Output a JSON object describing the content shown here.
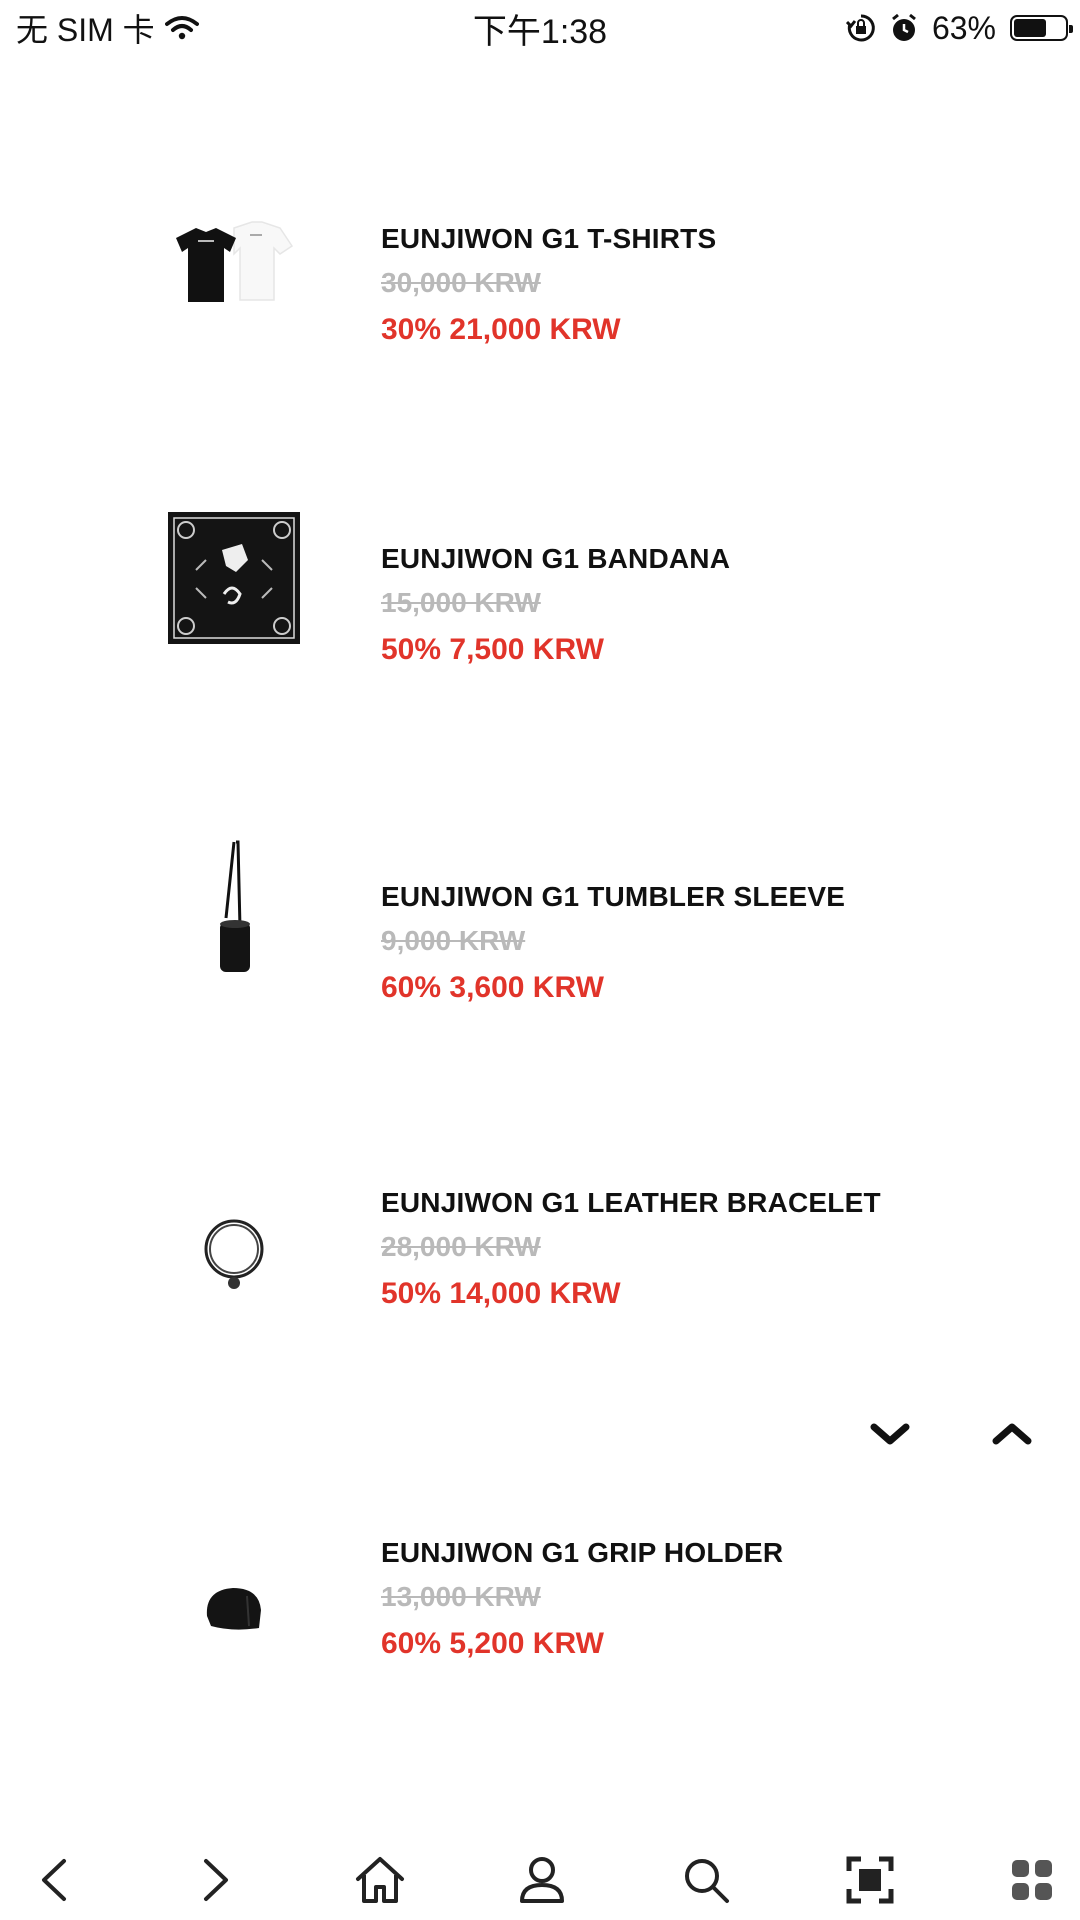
{
  "status_bar": {
    "carrier": "无 SIM 卡",
    "time": "下午1:38",
    "battery_percent": "63%",
    "battery_level": 0.63,
    "icons": [
      "wifi-icon",
      "orientation-lock-icon",
      "alarm-icon",
      "battery-icon"
    ]
  },
  "products": [
    {
      "name": "EUNJIWON G1 T-SHIRTS",
      "original_price": "30,000 KRW",
      "sale_price": "30% 21,000 KRW"
    },
    {
      "name": "EUNJIWON G1 BANDANA",
      "original_price": "15,000 KRW",
      "sale_price": "50% 7,500 KRW"
    },
    {
      "name": "EUNJIWON G1 TUMBLER SLEEVE",
      "original_price": "9,000 KRW",
      "sale_price": "60% 3,600 KRW"
    },
    {
      "name": "EUNJIWON G1 LEATHER BRACELET",
      "original_price": "28,000 KRW",
      "sale_price": "50% 14,000 KRW"
    },
    {
      "name": "EUNJIWON G1 GRIP HOLDER",
      "original_price": "13,000 KRW",
      "sale_price": "60% 5,200 KRW"
    }
  ],
  "scroll_controls": [
    "chevron-down-icon",
    "chevron-up-icon"
  ],
  "bottom_nav": [
    "back-icon",
    "forward-icon",
    "home-icon",
    "account-icon",
    "search-icon",
    "scan-icon",
    "apps-grid-icon"
  ],
  "colors": {
    "sale_red": "#e1342a",
    "strikethrough_gray": "#b9b9b9",
    "text_black": "#111111"
  }
}
